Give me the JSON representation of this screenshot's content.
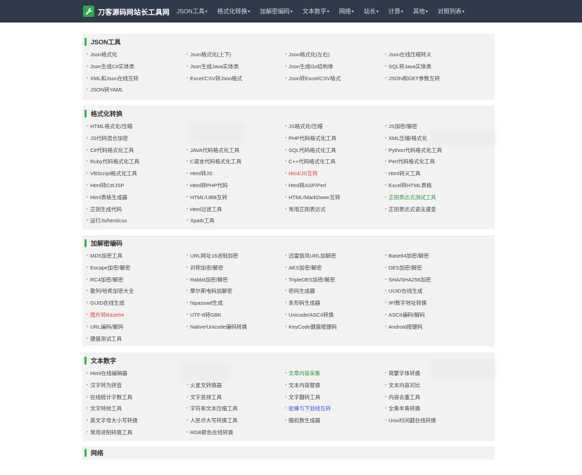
{
  "navbar": {
    "logo_text": "刀客源码网站长工具网",
    "items": [
      "JSON工具",
      "格式化转换",
      "加解密编码",
      "文本数字",
      "网络",
      "站长",
      "计算",
      "其他",
      "对照列表"
    ]
  },
  "sections": [
    {
      "title": "JSON工具",
      "items": [
        {
          "label": "Json格式化"
        },
        {
          "label": "Json格式化(上下)"
        },
        {
          "label": "Json格式化(左右)"
        },
        {
          "label": "Json在线压缩转义"
        },
        {
          "label": "Json生成C#实体类"
        },
        {
          "label": "Json生成Java实体类"
        },
        {
          "label": "Json生成Go结构体"
        },
        {
          "label": "SQL转Java实体类"
        },
        {
          "label": "XML和Json在线互转"
        },
        {
          "label": "Excel/CSV转Json格式"
        },
        {
          "label": "Json转Excel/CSV格式"
        },
        {
          "label": "JSON和GET参数互转"
        },
        {
          "label": "JSON转YAML"
        }
      ]
    },
    {
      "title": "格式化转换",
      "items": [
        {
          "label": "HTML格式化/压缩"
        },
        {
          "label": ""
        },
        {
          "label": "JS格式化/压缩"
        },
        {
          "label": "JS加密/解密"
        },
        {
          "label": "JS代码混合加密"
        },
        {
          "label": ""
        },
        {
          "label": "PHP代码格式化工具"
        },
        {
          "label": "XML压缩/格式化"
        },
        {
          "label": "C#代码格式化工具"
        },
        {
          "label": "JAVA代码格式化工具"
        },
        {
          "label": "SQL代码格式化工具"
        },
        {
          "label": "Python代码格式化工具"
        },
        {
          "label": "Ruby代码格式化工具"
        },
        {
          "label": "C语言代码格式化工具"
        },
        {
          "label": "C++代码格式化工具"
        },
        {
          "label": "Perl代码格式化工具"
        },
        {
          "label": "VBScript格式化工具"
        },
        {
          "label": "Html转JS"
        },
        {
          "label": "Html/JS互转",
          "color": "red"
        },
        {
          "label": "Html转义工具"
        },
        {
          "label": "Html转C#/JSP"
        },
        {
          "label": "Html转PHP代码"
        },
        {
          "label": "Html转ASP/Perl"
        },
        {
          "label": "Excel转HTML表格"
        },
        {
          "label": "Html表格生成器"
        },
        {
          "label": "HTML/UBB互转"
        },
        {
          "label": "HTML/MarkDown互转"
        },
        {
          "label": "正则表达式测试工具",
          "color": "green"
        },
        {
          "label": "正则生成代码"
        },
        {
          "label": "Html过滤工具"
        },
        {
          "label": "常用正则表达式"
        },
        {
          "label": "正则表达式语法速查"
        },
        {
          "label": "运行Js/html/css"
        },
        {
          "label": "Xpath工具"
        }
      ]
    },
    {
      "title": "加解密编码",
      "items": [
        {
          "label": "MD5加密工具"
        },
        {
          "label": "URL网址16进制加密"
        },
        {
          "label": "迅雷旋风URL加解密"
        },
        {
          "label": "Base64加密/解密"
        },
        {
          "label": "Escape加密/解密"
        },
        {
          "label": "对称加密/解密"
        },
        {
          "label": "AES加密/解密"
        },
        {
          "label": "DES加密/解密"
        },
        {
          "label": "RC4加密/解密"
        },
        {
          "label": "Rabbit加密/解密"
        },
        {
          "label": "TripleDES加密/解密"
        },
        {
          "label": "SHA/SHA256加密"
        },
        {
          "label": "散列/哈希加密大全"
        },
        {
          "label": "摩尔斯电码加解密"
        },
        {
          "label": "密码生成器"
        },
        {
          "label": "UUID在线生成"
        },
        {
          "label": "GUID在线生成"
        },
        {
          "label": "htpasswd生成"
        },
        {
          "label": "条形码生成器"
        },
        {
          "label": "IP/数字地址转换"
        },
        {
          "label": "图片转Base64",
          "color": "red"
        },
        {
          "label": "UTF-8转GBK"
        },
        {
          "label": "Unicode/ASCII转换"
        },
        {
          "label": "ASCII编码/解码"
        },
        {
          "label": "URL编码/解码"
        },
        {
          "label": "Native/Unicode编码转换"
        },
        {
          "label": "KeyCode键盘按键码"
        },
        {
          "label": "Android按键码"
        },
        {
          "label": "键盘测试工具"
        }
      ]
    },
    {
      "title": "文本数字",
      "items": [
        {
          "label": "Html在线编辑器"
        },
        {
          "label": ""
        },
        {
          "label": "文章内容采集",
          "color": "green"
        },
        {
          "label": "简繁字体转换"
        },
        {
          "label": "汉字转为拼音"
        },
        {
          "label": "火星文转换器"
        },
        {
          "label": "文本内容替换"
        },
        {
          "label": "文本内容对比"
        },
        {
          "label": "在线统计字数工具"
        },
        {
          "label": "文字竖排工具"
        },
        {
          "label": "文字翻转工具"
        },
        {
          "label": "内容去重工具"
        },
        {
          "label": "文字特效工具"
        },
        {
          "label": "字符串文本压缩工具"
        },
        {
          "label": "驼峰与下划线互转",
          "color": "blue"
        },
        {
          "label": "全角半角转换"
        },
        {
          "label": "英文字母大小写转换"
        },
        {
          "label": "人民币大写转换工具"
        },
        {
          "label": "随机数生成器"
        },
        {
          "label": "Unix时间戳在线转换"
        },
        {
          "label": "常用进制转换工具"
        },
        {
          "label": "RGB颜色在线转换"
        }
      ]
    },
    {
      "title": "网络",
      "items": []
    }
  ]
}
